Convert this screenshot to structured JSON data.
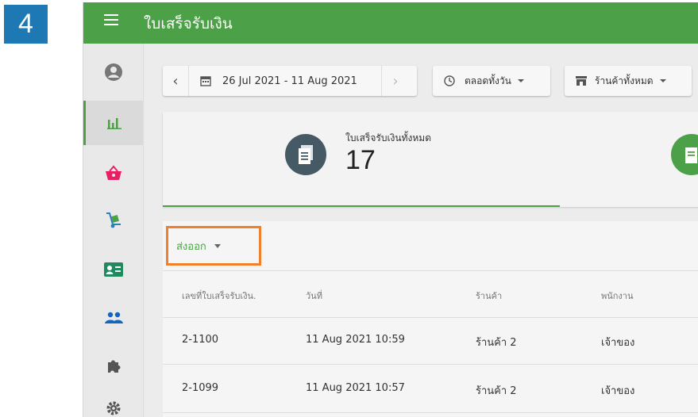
{
  "step_badge": "4",
  "app": {
    "title": "ใบเสร็จรับเงิน"
  },
  "colors": {
    "primary": "#4CA047",
    "badge": "#1E78B4",
    "highlight": "#F0802C",
    "receipt_icon": "#455A64",
    "basket": "#E91E63"
  },
  "sidebar": {
    "items": [
      {
        "icon": "account-circle-icon"
      },
      {
        "icon": "bar-chart-icon",
        "active": true
      },
      {
        "icon": "basket-icon"
      },
      {
        "icon": "hand-truck-icon"
      },
      {
        "icon": "id-card-icon"
      },
      {
        "icon": "people-icon"
      },
      {
        "icon": "puzzle-icon"
      },
      {
        "icon": "gear-icon"
      }
    ]
  },
  "toolbar": {
    "prev": "‹",
    "date_range": "26 Jul 2021 - 11 Aug 2021",
    "next": "›",
    "time_filter": "ตลอดทั้งวัน",
    "store_filter": "ร้านค้าทั้งหมด"
  },
  "kpi": {
    "label": "ใบเสร็จรับเงินทั้งหมด",
    "value": "17"
  },
  "export": {
    "label": "ส่งออก"
  },
  "table": {
    "headers": [
      "เลขที่ใบเสร็จรับเงิน.",
      "วันที่",
      "ร้านค้า",
      "พนักงาน"
    ],
    "rows": [
      [
        "2-1100",
        "11 Aug 2021 10:59",
        "ร้านค้า 2",
        "เจ้าของ"
      ],
      [
        "2-1099",
        "11 Aug 2021 10:57",
        "ร้านค้า 2",
        "เจ้าของ"
      ]
    ]
  }
}
